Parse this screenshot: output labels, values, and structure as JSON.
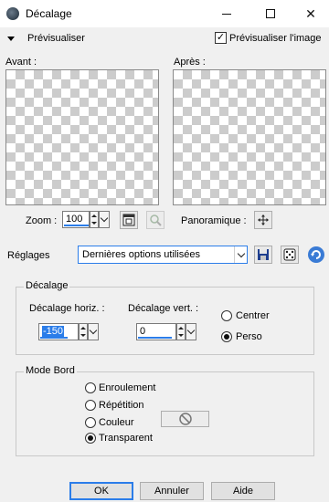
{
  "window": {
    "title": "Décalage"
  },
  "preview": {
    "toggle_label": "Prévisualiser",
    "preview_image_label": "Prévisualiser l'image",
    "preview_image_checked": true,
    "before_label": "Avant :",
    "after_label": "Après :"
  },
  "zoom": {
    "label": "Zoom :",
    "value": "100",
    "panoramic_label": "Panoramique :",
    "panoramic_icon": "move-icon"
  },
  "settings": {
    "label": "Réglages",
    "preset": "Dernières options utilisées"
  },
  "offset_group": {
    "title": "Décalage",
    "horizontal_label": "Décalage horiz. :",
    "horizontal_value": "-150",
    "vertical_label": "Décalage vert. :",
    "vertical_value": "0",
    "options": [
      {
        "label": "Centrer",
        "selected": false
      },
      {
        "label": "Perso",
        "selected": true
      }
    ]
  },
  "edge_mode": {
    "title": "Mode Bord",
    "options": [
      {
        "label": "Enroulement",
        "selected": false
      },
      {
        "label": "Répétition",
        "selected": false
      },
      {
        "label": "Couleur",
        "selected": false
      },
      {
        "label": "Transparent",
        "selected": true
      }
    ]
  },
  "buttons": {
    "ok": "OK",
    "cancel": "Annuler",
    "help": "Aide"
  },
  "colors": {
    "accent": "#2b7de9",
    "background": "#f0f0f0"
  }
}
